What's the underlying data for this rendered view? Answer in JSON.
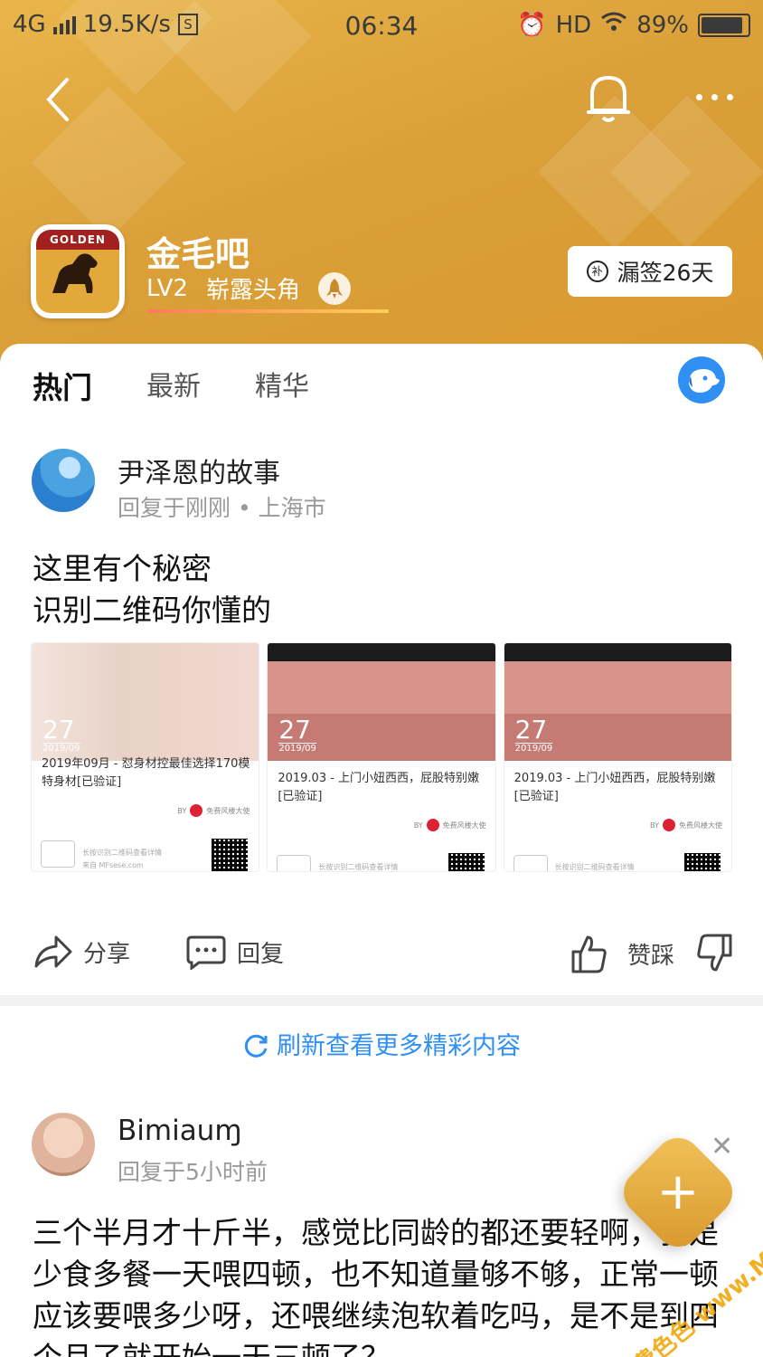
{
  "status_bar": {
    "network": "4G",
    "speed": "19.5K/s",
    "sim_icon": "S",
    "time": "06:34",
    "hd": "HD",
    "battery": "89%",
    "battery_level": 0.89
  },
  "forum": {
    "logo_text": "GOLDEN",
    "name": "金毛吧",
    "level": "LV2",
    "title": "崭露头角",
    "level_progress": 1.0,
    "sign_label": "漏签26天",
    "sign_icon": "补"
  },
  "tabs": [
    "热门",
    "最新",
    "精华"
  ],
  "post1": {
    "username": "尹泽恩的故事",
    "meta": "回复于刚刚 • 上海市",
    "text_line1": "这里有个秘密",
    "text_line2": "识别二维码你懂的",
    "cards": [
      {
        "day": "27",
        "month": "2019/09",
        "caption": "2019年09月 - 怼身材控最佳选择170模特身材[已验证]",
        "by": "免费风楼大使",
        "foot1": "长按识别二维码查看详情",
        "foot2": "来自 MFsese.com"
      },
      {
        "day": "27",
        "month": "2019/09",
        "caption": "2019.03 - 上门小妞西西，屁股特别嫩[已验证]",
        "by": "免费风楼大使",
        "foot1": "长按识别二维码查看详情",
        "foot2": ""
      },
      {
        "day": "27",
        "month": "2019/09",
        "caption": "2019.03 - 上门小妞西西，屁股特别嫩[已验证]",
        "by": "免费风楼大使",
        "foot1": "长按识别二维码查看详情",
        "foot2": ""
      }
    ],
    "actions": {
      "share": "分享",
      "reply": "回复",
      "vote": "赞踩"
    }
  },
  "refresh_label": "刷新查看更多精彩内容",
  "post2": {
    "username": "Bimiauɱ",
    "meta": "回复于5小时前",
    "text": "三个半月才十斤半，感觉比同龄的都还要轻啊，我是少食多餐一天喂四顿，也不知道量够不够，正常一顿应该要喂多少呀，还喂继续泡软着吃吗，是不是到四个月了就开始一天三顿了？"
  },
  "fab_label": "+",
  "watermark": "免费色色 www.MFsese.com"
}
